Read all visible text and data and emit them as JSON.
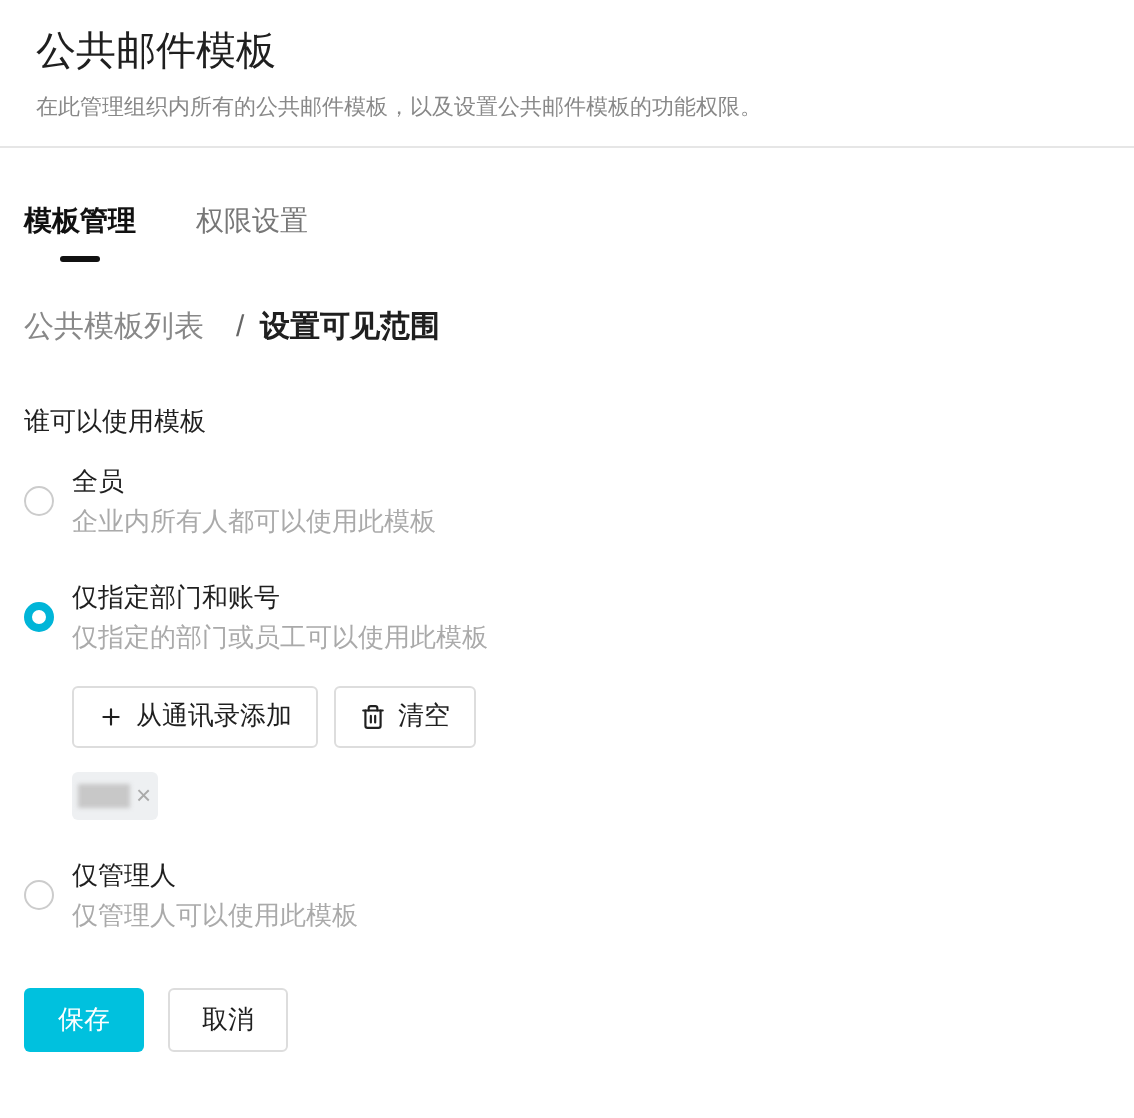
{
  "header": {
    "title": "公共邮件模板",
    "description": "在此管理组织内所有的公共邮件模板，以及设置公共邮件模板的功能权限。"
  },
  "tabs": [
    {
      "label": "模板管理",
      "selected": true
    },
    {
      "label": "权限设置",
      "selected": false
    }
  ],
  "breadcrumb": {
    "parent": "公共模板列表",
    "separator": "/",
    "current": "设置可见范围"
  },
  "visibility": {
    "label": "谁可以使用模板",
    "options": [
      {
        "title": "全员",
        "description": "企业内所有人都可以使用此模板",
        "selected": false
      },
      {
        "title": "仅指定部门和账号",
        "description": "仅指定的部门或员工可以使用此模板",
        "selected": true,
        "actions": [
          {
            "kind": "add",
            "label": "从通讯录添加"
          },
          {
            "kind": "clear",
            "label": "清空"
          }
        ],
        "chips": [
          {
            "kind": "redacted",
            "remove": "×"
          }
        ]
      },
      {
        "title": "仅管理人",
        "description": "仅管理人可以使用此模板",
        "selected": false
      }
    ]
  },
  "buttons": [
    {
      "kind": "primary",
      "label": "保存"
    },
    {
      "kind": "secondary",
      "label": "取消"
    }
  ]
}
